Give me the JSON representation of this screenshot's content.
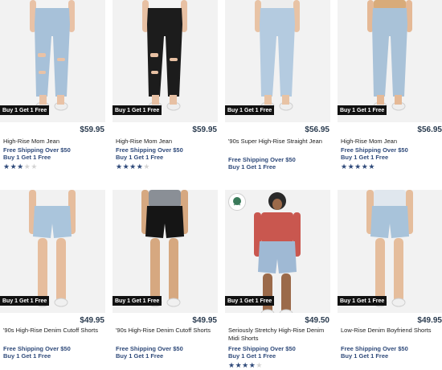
{
  "products": [
    {
      "title": "High-Rise Mom Jean",
      "price": "$59.95",
      "badge": "Buy 1 Get 1 Free",
      "promo1": "Free Shipping Over $50",
      "promo2": "Buy 1 Get 1 Free",
      "rating": 3,
      "skin": "#e9c2a6",
      "top": "#f3f3f3",
      "pants": "#a7c1d9",
      "pants_style": "long-ripped"
    },
    {
      "title": "High-Rise Mom Jean",
      "price": "$59.95",
      "badge": "Buy 1 Get 1 Free",
      "promo1": "Free Shipping Over $50",
      "promo2": "Buy 1 Get 1 Free",
      "rating": 4,
      "skin": "#e7c0a3",
      "top": "#f5f5f5",
      "pants": "#1c1c1c",
      "pants_style": "long-ripped"
    },
    {
      "title": "'90s Super High-Rise Straight Jean",
      "price": "$56.95",
      "badge": "Buy 1 Get 1 Free",
      "promo1": "Free Shipping Over $50",
      "promo2": "Buy 1 Get 1 Free",
      "rating": null,
      "skin": "#e8c3a5",
      "top": "#ededed",
      "pants": "#b4cbe0",
      "pants_style": "long"
    },
    {
      "title": "High-Rise Mom Jean",
      "price": "$56.95",
      "badge": "Buy 1 Get 1 Free",
      "promo1": "Free Shipping Over $50",
      "promo2": "Buy 1 Get 1 Free",
      "rating": 5,
      "skin": "#e5b996",
      "top": "#d8ab7a",
      "pants": "#a9c2d8",
      "pants_style": "long"
    },
    {
      "title": "'90s High-Rise Denim Cutoff Shorts",
      "price": "$49.95",
      "badge": "Buy 1 Get 1 Free",
      "promo1": "Free Shipping Over $50",
      "promo2": "Buy 1 Get 1 Free",
      "rating": null,
      "skin": "#e6bd9d",
      "top": "#f1f1f1",
      "pants": "#aac5dc",
      "pants_style": "shorts"
    },
    {
      "title": "'90s High-Rise Denim Cutoff Shorts",
      "price": "$49.95",
      "badge": "Buy 1 Get 1 Free",
      "promo1": "Free Shipping Over $50",
      "promo2": "Buy 1 Get 1 Free",
      "rating": null,
      "skin": "#d6a880",
      "top": "#8a8f96",
      "pants": "#151515",
      "pants_style": "shorts"
    },
    {
      "title": "Seriously Stretchy High-Rise Denim Midi Shorts",
      "price": "$49.50",
      "badge": "Buy 1 Get 1 Free",
      "promo1": "Free Shipping Over $50",
      "promo2": "Buy 1 Get 1 Free",
      "rating": 4,
      "skin": "#9b6a4a",
      "top": "#c9574f",
      "pants": "#9fb9d4",
      "pants_style": "shorts",
      "eco_badge": true
    },
    {
      "title": "Low-Rise Denim Boyfriend Shorts",
      "price": "$49.95",
      "badge": "Buy 1 Get 1 Free",
      "promo1": "Free Shipping Over $50",
      "promo2": "Buy 1 Get 1 Free",
      "rating": null,
      "skin": "#e5bd9c",
      "top": "#e0e7ee",
      "pants": "#a8c3da",
      "pants_style": "shorts"
    }
  ]
}
